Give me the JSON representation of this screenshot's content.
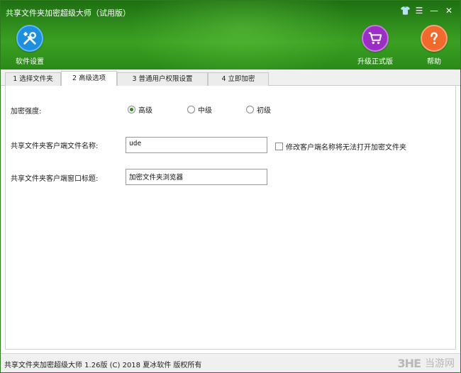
{
  "window": {
    "title": "共享文件夹加密超级大师（试用版）",
    "controls": {
      "skin": "👕",
      "menu": "☰",
      "minimize": "—",
      "close": "✕"
    }
  },
  "toolbar": {
    "settings_label": "软件设置",
    "upgrade_label": "升级正式版",
    "help_label": "帮助"
  },
  "tabs": [
    {
      "label": "1 选择文件夹"
    },
    {
      "label": "2 高级选项"
    },
    {
      "label": "3 普通用户权限设置"
    },
    {
      "label": "4 立即加密"
    }
  ],
  "form": {
    "strength_label": "加密强度:",
    "strength_options": [
      "高级",
      "中级",
      "初级"
    ],
    "strength_selected": "高级",
    "client_name_label": "共享文件夹客户端文件名称:",
    "client_name_value": "ude",
    "rename_warning_label": "修改客户端名称将无法打开加密文件夹",
    "window_title_label": "共享文件夹客户端窗口标题:",
    "window_title_value": "加密文件夹浏览器"
  },
  "status_bar": {
    "text": "共享文件夹加密超级大师  1.26版  (C)  2018  夏冰软件  版权所有"
  },
  "watermark": {
    "logo": "3HE",
    "site": "当游网"
  },
  "colors": {
    "header_green": "#2f8d1c",
    "settings_blue": "#1d8fdd",
    "upgrade_purple": "#9b2fc4",
    "help_orange": "#f06a2e"
  }
}
